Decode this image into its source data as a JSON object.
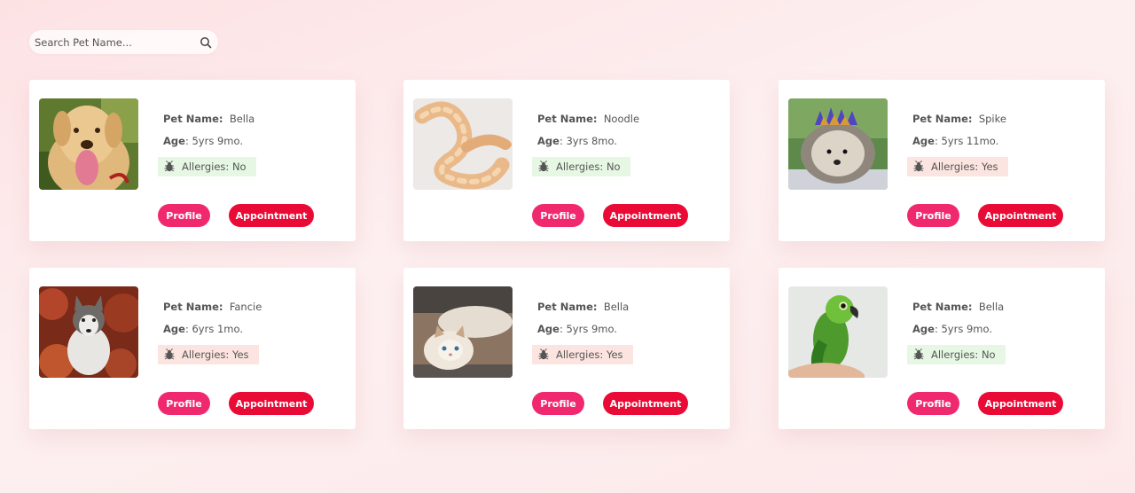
{
  "search": {
    "placeholder": "Search Pet Name..."
  },
  "labels": {
    "name": "Pet Name:",
    "age": "Age",
    "allergies": "Allergies:",
    "profile": "Profile",
    "appointment": "Appointment"
  },
  "pets": [
    {
      "name": "Bella",
      "age": "5yrs 9mo.",
      "allergies": "No",
      "photo": "dog"
    },
    {
      "name": "Noodle",
      "age": "3yrs 8mo.",
      "allergies": "No",
      "photo": "snake"
    },
    {
      "name": "Spike",
      "age": "5yrs 11mo.",
      "allergies": "Yes",
      "photo": "hedgehog"
    },
    {
      "name": "Fancie",
      "age": "6yrs 1mo.",
      "allergies": "Yes",
      "photo": "husky"
    },
    {
      "name": "Bella",
      "age": "5yrs 9mo.",
      "allergies": "Yes",
      "photo": "cat"
    },
    {
      "name": "Bella",
      "age": "5yrs 9mo.",
      "allergies": "No",
      "photo": "parrot"
    }
  ],
  "colors": {
    "profile_button": "#f0296f",
    "appointment_button": "#ea0a36",
    "allergy_no_bg": "#e6f8e4",
    "allergy_yes_bg": "#fce4e0"
  }
}
